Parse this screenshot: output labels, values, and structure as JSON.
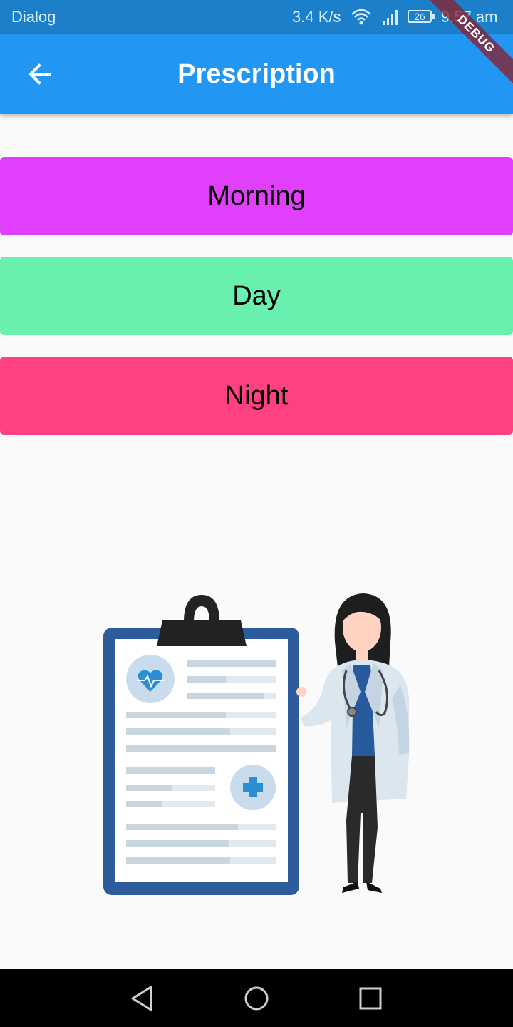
{
  "status_bar": {
    "left_text": "Dialog",
    "speed": "3.4 K/s",
    "battery": "26",
    "time": "9:57 am",
    "icons": [
      "wifi-icon",
      "signal-icon",
      "battery-icon"
    ]
  },
  "debug_banner": "DEBUG",
  "app_bar": {
    "title": "Prescription",
    "back_icon": "arrow-back-icon",
    "color": "#2196f3"
  },
  "buttons": {
    "morning": {
      "label": "Morning",
      "color": "#e040fb"
    },
    "day": {
      "label": "Day",
      "color": "#69f0ae"
    },
    "night": {
      "label": "Night",
      "color": "#ff4081"
    }
  },
  "illustration": {
    "subject": "doctor-with-clipboard-illustration"
  },
  "nav_bar": {
    "buttons": [
      "nav-back-icon",
      "nav-home-icon",
      "nav-recents-icon"
    ]
  }
}
